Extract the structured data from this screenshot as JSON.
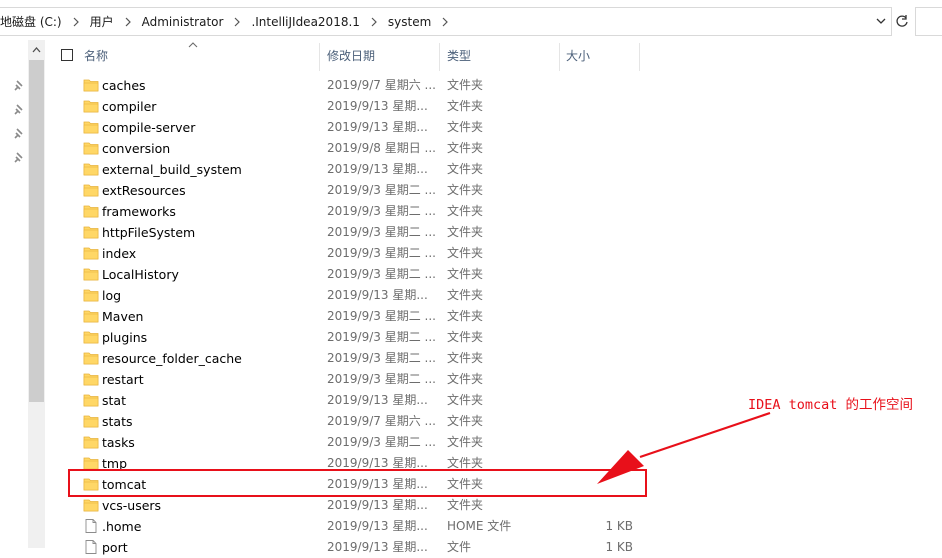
{
  "address_bar": {
    "breadcrumbs": [
      "地磁盘 (C:)",
      "用户",
      "Administrator",
      ".IntelliJIdea2018.1",
      "system"
    ]
  },
  "columns": {
    "name": "名称",
    "date": "修改日期",
    "type": "类型",
    "size": "大小"
  },
  "files": [
    {
      "name": "caches",
      "date": "2019/9/7 星期六 ...",
      "type": "文件夹",
      "size": "",
      "icon": "folder-icon"
    },
    {
      "name": "compiler",
      "date": "2019/9/13 星期...",
      "type": "文件夹",
      "size": "",
      "icon": "folder-icon"
    },
    {
      "name": "compile-server",
      "date": "2019/9/13 星期...",
      "type": "文件夹",
      "size": "",
      "icon": "folder-icon"
    },
    {
      "name": "conversion",
      "date": "2019/9/8 星期日 ...",
      "type": "文件夹",
      "size": "",
      "icon": "folder-icon"
    },
    {
      "name": "external_build_system",
      "date": "2019/9/13 星期...",
      "type": "文件夹",
      "size": "",
      "icon": "folder-icon"
    },
    {
      "name": "extResources",
      "date": "2019/9/3 星期二 ...",
      "type": "文件夹",
      "size": "",
      "icon": "folder-icon"
    },
    {
      "name": "frameworks",
      "date": "2019/9/3 星期二 ...",
      "type": "文件夹",
      "size": "",
      "icon": "folder-icon"
    },
    {
      "name": "httpFileSystem",
      "date": "2019/9/3 星期二 ...",
      "type": "文件夹",
      "size": "",
      "icon": "folder-icon"
    },
    {
      "name": "index",
      "date": "2019/9/3 星期二 ...",
      "type": "文件夹",
      "size": "",
      "icon": "folder-icon"
    },
    {
      "name": "LocalHistory",
      "date": "2019/9/3 星期二 ...",
      "type": "文件夹",
      "size": "",
      "icon": "folder-icon"
    },
    {
      "name": "log",
      "date": "2019/9/13 星期...",
      "type": "文件夹",
      "size": "",
      "icon": "folder-icon"
    },
    {
      "name": "Maven",
      "date": "2019/9/3 星期二 ...",
      "type": "文件夹",
      "size": "",
      "icon": "folder-icon"
    },
    {
      "name": "plugins",
      "date": "2019/9/3 星期二 ...",
      "type": "文件夹",
      "size": "",
      "icon": "folder-icon"
    },
    {
      "name": "resource_folder_cache",
      "date": "2019/9/3 星期二 ...",
      "type": "文件夹",
      "size": "",
      "icon": "folder-icon"
    },
    {
      "name": "restart",
      "date": "2019/9/3 星期二 ...",
      "type": "文件夹",
      "size": "",
      "icon": "folder-icon"
    },
    {
      "name": "stat",
      "date": "2019/9/13 星期...",
      "type": "文件夹",
      "size": "",
      "icon": "folder-icon"
    },
    {
      "name": "stats",
      "date": "2019/9/7 星期六 ...",
      "type": "文件夹",
      "size": "",
      "icon": "folder-icon"
    },
    {
      "name": "tasks",
      "date": "2019/9/3 星期二 ...",
      "type": "文件夹",
      "size": "",
      "icon": "folder-icon"
    },
    {
      "name": "tmp",
      "date": "2019/9/13 星期...",
      "type": "文件夹",
      "size": "",
      "icon": "folder-icon"
    },
    {
      "name": "tomcat",
      "date": "2019/9/13 星期...",
      "type": "文件夹",
      "size": "",
      "icon": "folder-icon"
    },
    {
      "name": "vcs-users",
      "date": "2019/9/13 星期...",
      "type": "文件夹",
      "size": "",
      "icon": "folder-icon"
    },
    {
      "name": ".home",
      "date": "2019/9/13 星期...",
      "type": "HOME 文件",
      "size": "1 KB",
      "icon": "file-icon"
    },
    {
      "name": "port",
      "date": "2019/9/13 星期...",
      "type": "文件",
      "size": "1 KB",
      "icon": "file-icon"
    }
  ],
  "annotation": {
    "text": "IDEA tomcat 的工作空间",
    "color": "#e8101a"
  },
  "colors": {
    "folder": "#ffd766",
    "folder_dark": "#e8b33b",
    "header_text": "#4c607a",
    "highlight": "#e8101a"
  }
}
